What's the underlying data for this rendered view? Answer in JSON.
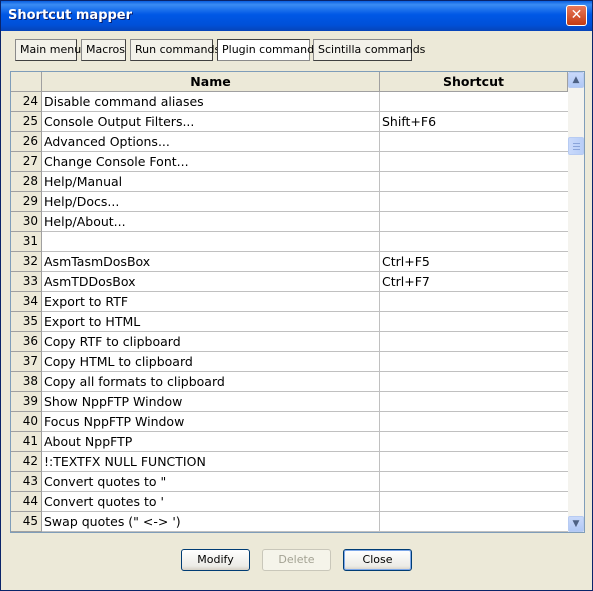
{
  "window": {
    "title": "Shortcut mapper",
    "close_glyph": "✕"
  },
  "tabs": [
    {
      "label": "Main menu",
      "active": false
    },
    {
      "label": "Macros",
      "active": false
    },
    {
      "label": "Run commands",
      "active": false
    },
    {
      "label": "Plugin commands",
      "active": true
    },
    {
      "label": "Scintilla commands",
      "active": false
    }
  ],
  "grid": {
    "columns": {
      "name": "Name",
      "shortcut": "Shortcut"
    },
    "rows": [
      {
        "num": "24",
        "name": "Disable command aliases",
        "shortcut": ""
      },
      {
        "num": "25",
        "name": "Console Output Filters...",
        "shortcut": "Shift+F6"
      },
      {
        "num": "26",
        "name": "Advanced Options...",
        "shortcut": ""
      },
      {
        "num": "27",
        "name": "Change Console Font...",
        "shortcut": ""
      },
      {
        "num": "28",
        "name": "Help/Manual",
        "shortcut": ""
      },
      {
        "num": "29",
        "name": "Help/Docs...",
        "shortcut": ""
      },
      {
        "num": "30",
        "name": "Help/About...",
        "shortcut": ""
      },
      {
        "num": "31",
        "name": "",
        "shortcut": ""
      },
      {
        "num": "32",
        "name": "AsmTasmDosBox",
        "shortcut": "Ctrl+F5"
      },
      {
        "num": "33",
        "name": "AsmTDDosBox",
        "shortcut": "Ctrl+F7"
      },
      {
        "num": "34",
        "name": "Export to RTF",
        "shortcut": ""
      },
      {
        "num": "35",
        "name": "Export to HTML",
        "shortcut": ""
      },
      {
        "num": "36",
        "name": "Copy RTF to clipboard",
        "shortcut": ""
      },
      {
        "num": "37",
        "name": "Copy HTML to clipboard",
        "shortcut": ""
      },
      {
        "num": "38",
        "name": "Copy all formats to clipboard",
        "shortcut": ""
      },
      {
        "num": "39",
        "name": "Show NppFTP Window",
        "shortcut": ""
      },
      {
        "num": "40",
        "name": "Focus NppFTP Window",
        "shortcut": ""
      },
      {
        "num": "41",
        "name": "About NppFTP",
        "shortcut": ""
      },
      {
        "num": "42",
        "name": "!:TEXTFX NULL FUNCTION",
        "shortcut": ""
      },
      {
        "num": "43",
        "name": "Convert quotes to \"",
        "shortcut": ""
      },
      {
        "num": "44",
        "name": "Convert quotes to '",
        "shortcut": ""
      },
      {
        "num": "45",
        "name": "Swap quotes (\" <-> ')",
        "shortcut": ""
      }
    ]
  },
  "scrollbar": {
    "up_glyph": "▲",
    "down_glyph": "▼"
  },
  "buttons": {
    "modify": "Modify",
    "delete": "Delete",
    "close": "Close"
  },
  "colors": {
    "titlebar": "#0058E6",
    "window_bg": "#ECE9D8",
    "grid_border": "#7F9DB9"
  }
}
